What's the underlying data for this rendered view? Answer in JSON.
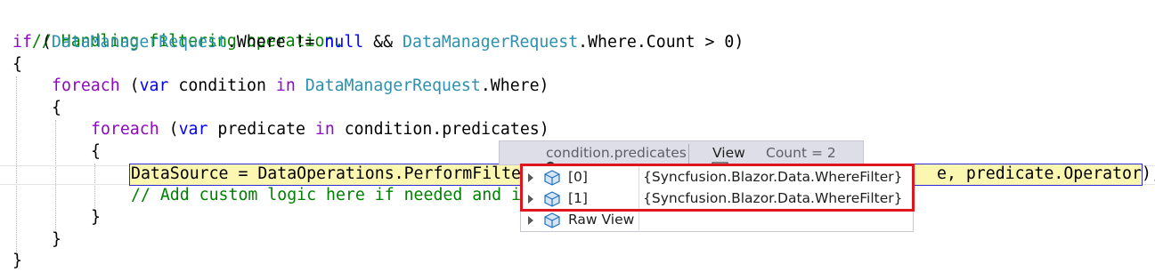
{
  "code": {
    "line1": {
      "comment": "// Handling filtering operation."
    },
    "line2": {
      "kw_if": "if",
      "open": " (",
      "type1": "DataManagerRequest",
      "mid1": ".Where != ",
      "kw_null": "null",
      "mid2": " && ",
      "type2": "DataManagerRequest",
      "tail": ".Where.Count > 0)"
    },
    "line3": {
      "text": "{"
    },
    "line4": {
      "kw_foreach": "foreach",
      "open": " (",
      "kw_var": "var",
      "var_name": " condition ",
      "kw_in": "in",
      "space": " ",
      "type": "DataManagerRequest",
      "tail": ".Where)"
    },
    "line5": {
      "text": "{"
    },
    "line6": {
      "kw_foreach": "foreach",
      "open": " (",
      "kw_var": "var",
      "var_name": " predicate ",
      "kw_in": "in",
      "tail": " condition.predicates)"
    },
    "line7": {
      "text": "{"
    },
    "line8": {
      "text": "DataSource = DataOperations.PerformFilte",
      "text_right": "e, predicate.Operator);"
    },
    "line9": {
      "comment": "// Add custom logic here if needed and i"
    },
    "line10": {
      "text": "}"
    },
    "line11": {
      "text": "}"
    },
    "line12": {
      "text": "}"
    }
  },
  "datatip": {
    "header": {
      "expression": "condition.predicates",
      "view_label": "View",
      "count_text": "Count = 2"
    },
    "rows": [
      {
        "name": "[0]",
        "value": "{Syncfusion.Blazor.Data.WhereFilter}"
      },
      {
        "name": "[1]",
        "value": "{Syncfusion.Blazor.Data.WhereFilter}"
      },
      {
        "name": "Raw View",
        "value": ""
      }
    ]
  },
  "colors": {
    "keyword": "#0000ff",
    "control_keyword": "#8f08c4",
    "type": "#2b91af",
    "comment": "#008000",
    "highlight_bg": "#fbf6b0",
    "callout_border": "#e0161f"
  }
}
